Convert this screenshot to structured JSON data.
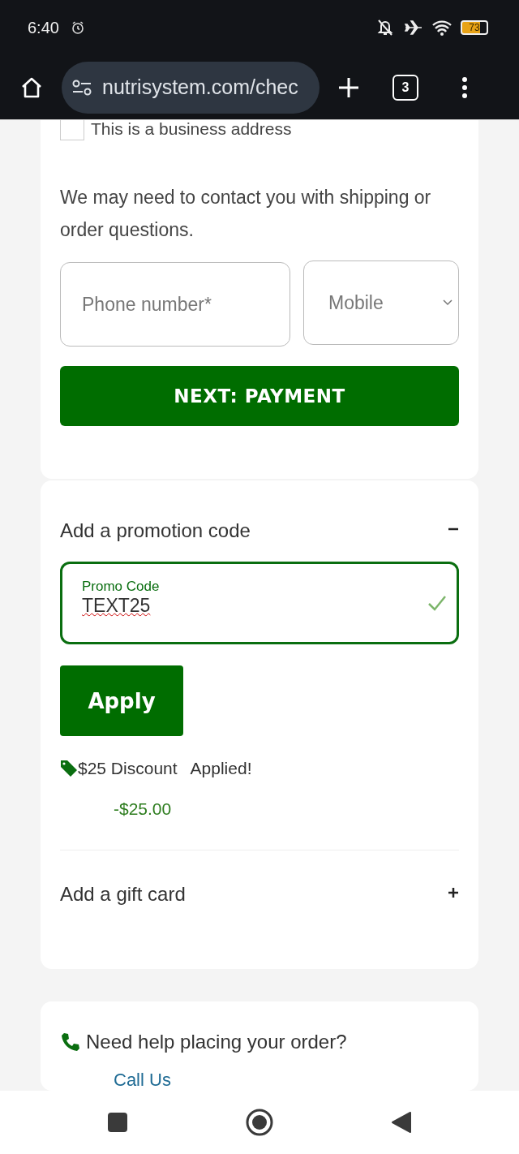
{
  "status_bar": {
    "time": "6:40",
    "battery": "73"
  },
  "browser": {
    "url": "nutrisystem.com/chec",
    "tab_count": "3"
  },
  "address": {
    "business_checkbox": {
      "label": "This is a business address",
      "checked": false
    }
  },
  "contact": {
    "note": "We may need to contact you with shipping or order questions.",
    "phone_field": {
      "placeholder": "Phone number*"
    },
    "phone_type": {
      "value": "Mobile"
    },
    "next_button": "NEXT: PAYMENT"
  },
  "promo": {
    "title": "Add a promotion code",
    "expanded": true,
    "field_label": "Promo Code",
    "value": "TEXT25",
    "valid": true,
    "apply_button": "Apply",
    "discount_label": "$25 Discount",
    "applied": "Applied!",
    "amount": "-$25.00"
  },
  "gift_card": {
    "title": "Add a gift card",
    "expanded": false
  },
  "help": {
    "text": "Need help placing your order?",
    "link": "Call Us"
  }
}
